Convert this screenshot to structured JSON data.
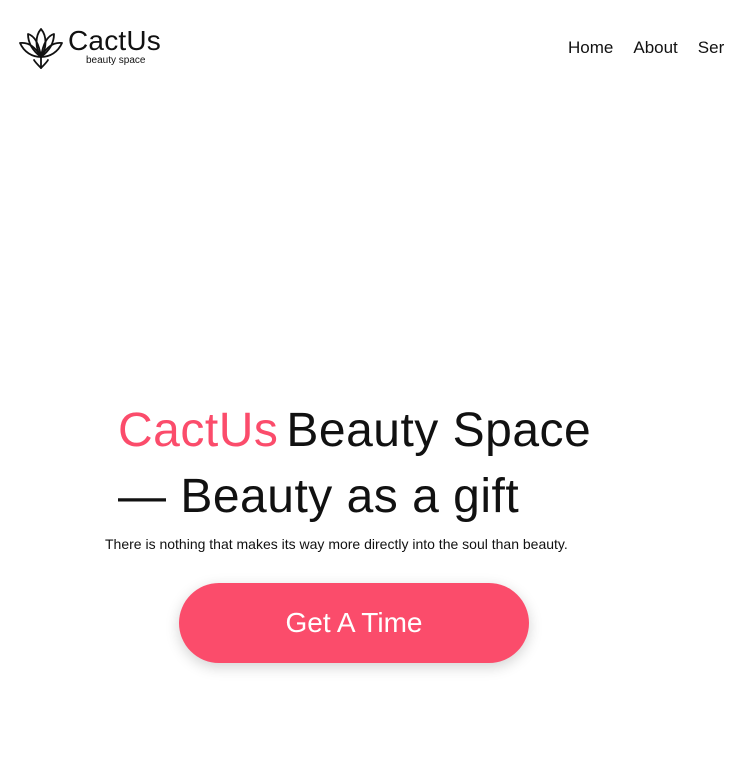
{
  "brand": {
    "name": "CactUs",
    "tagline": "beauty space",
    "logo_icon": "lotus-icon",
    "accent_color": "#fb4c6b"
  },
  "nav": {
    "items": [
      {
        "label": "Home"
      },
      {
        "label": "About"
      },
      {
        "label": "Ser"
      }
    ]
  },
  "hero": {
    "title_brand": "CactUs",
    "title_rest": "Beauty Space — Beauty as a gift",
    "subtitle": "There is nothing that makes its way more directly into the soul than beauty.",
    "cta_label": "Get A Time"
  }
}
